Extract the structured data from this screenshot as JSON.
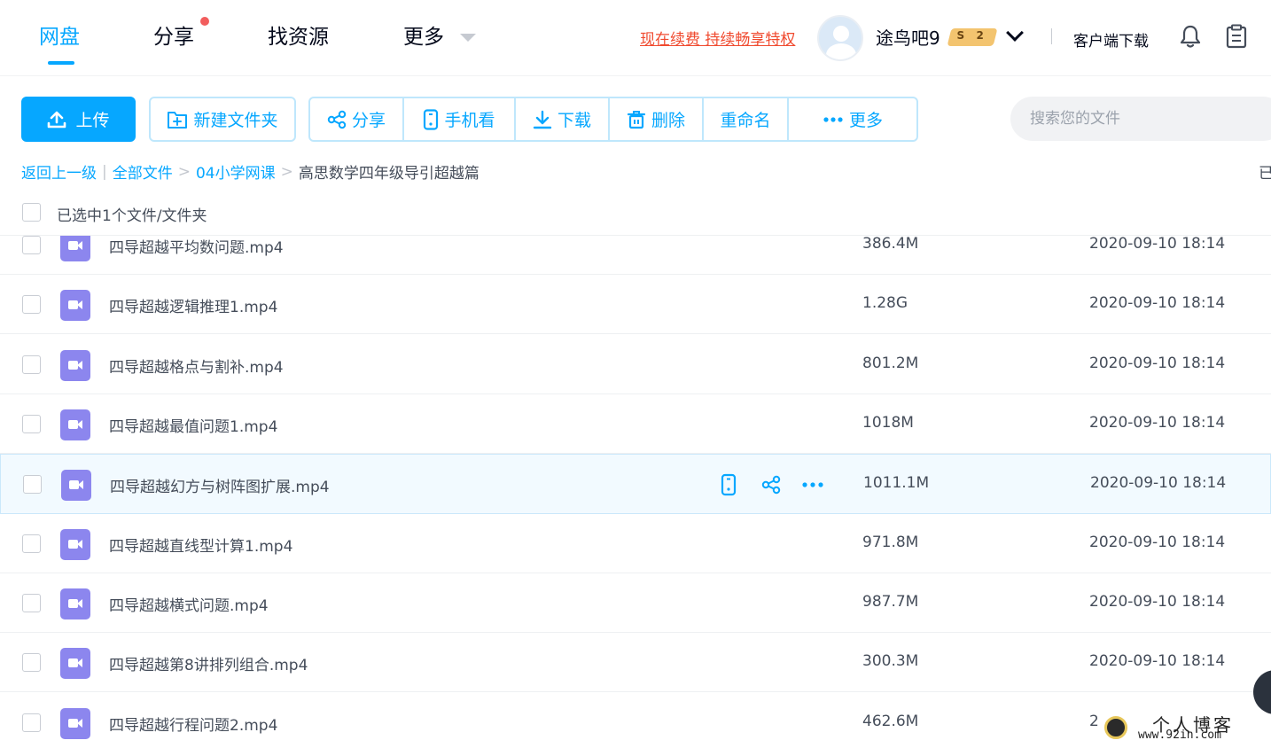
{
  "nav": {
    "tabs": [
      {
        "label": "网盘",
        "active": true
      },
      {
        "label": "分享",
        "has_dot": true
      },
      {
        "label": "找资源"
      },
      {
        "label": "更多"
      }
    ],
    "renew_link": "现在续费 持续畅享特权",
    "username": "途鸟吧9",
    "vip_badge": {
      "symbol": "S",
      "level": "2"
    },
    "client_download": "客户端下载",
    "icons": [
      "bell-icon",
      "clipboard-icon"
    ]
  },
  "toolbar": {
    "upload": "上传",
    "new_folder": "新建文件夹",
    "actions": [
      {
        "label": "分享",
        "icon": "share-icon"
      },
      {
        "label": "手机看",
        "icon": "phone-icon"
      },
      {
        "label": "下载",
        "icon": "download-icon"
      },
      {
        "label": "删除",
        "icon": "trash-icon"
      },
      {
        "label": "重命名",
        "icon": ""
      },
      {
        "label": "更多",
        "icon": "dots-icon"
      }
    ],
    "search_placeholder": "搜索您的文件"
  },
  "breadcrumb": {
    "back": "返回上一级",
    "items": [
      "全部文件",
      "04小学网课"
    ],
    "current": "高思数学四年级导引超越篇",
    "right_edge": "已"
  },
  "selection": {
    "text": "已选中1个文件/文件夹"
  },
  "files": [
    {
      "name": "四导超越平均数问题.mp4",
      "size": "386.4M",
      "date": "2020-09-10 18:14"
    },
    {
      "name": "四导超越逻辑推理1.mp4",
      "size": "1.28G",
      "date": "2020-09-10 18:14"
    },
    {
      "name": "四导超越格点与割补.mp4",
      "size": "801.2M",
      "date": "2020-09-10 18:14"
    },
    {
      "name": "四导超越最值问题1.mp4",
      "size": "1018M",
      "date": "2020-09-10 18:14"
    },
    {
      "name": "四导超越幻方与树阵图扩展.mp4",
      "size": "1011.1M",
      "date": "2020-09-10 18:14",
      "hovered": true
    },
    {
      "name": "四导超越直线型计算1.mp4",
      "size": "971.8M",
      "date": "2020-09-10 18:14"
    },
    {
      "name": "四导超越横式问题.mp4",
      "size": "987.7M",
      "date": "2020-09-10 18:14"
    },
    {
      "name": "四导超越第8讲排列组合.mp4",
      "size": "300.3M",
      "date": "2020-09-10 18:14"
    },
    {
      "name": "四导超越行程问题2.mp4",
      "size": "462.6M",
      "date": "2"
    }
  ],
  "watermark": {
    "title": "个人博客",
    "url": "www.92in.com"
  },
  "colors": {
    "accent": "#06a7ff",
    "renew": "#f04a2f",
    "video_icon": "#8c86ee",
    "hover_row": "#f2faff"
  }
}
